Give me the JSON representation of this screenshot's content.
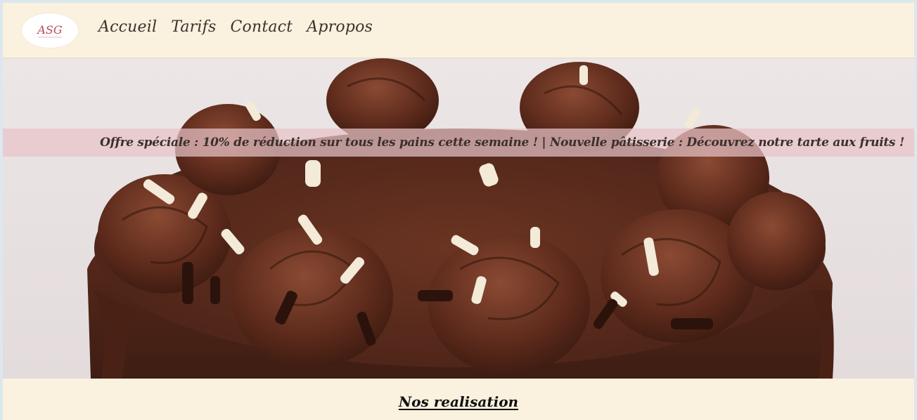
{
  "logo": {
    "text": "ASG",
    "icon": "bakery-logo-icon"
  },
  "nav": {
    "items": [
      {
        "label": "Accueil"
      },
      {
        "label": "Tarifs"
      },
      {
        "label": "Contact"
      },
      {
        "label": "Apropos"
      }
    ]
  },
  "hero": {
    "image": "chocolate-cake-image",
    "announcement": "Offre spéciale : 10% de réduction sur tous les pains cette semaine ! | Nouvelle pâtisserie : Découvrez notre tarte aux fruits !"
  },
  "section": {
    "title": "Nos realisation"
  },
  "colors": {
    "page_bg": "#faf1df",
    "ticker_bg": "#e7c4c7",
    "chocolate": "#5a2a1c",
    "text": "#3a332d"
  }
}
